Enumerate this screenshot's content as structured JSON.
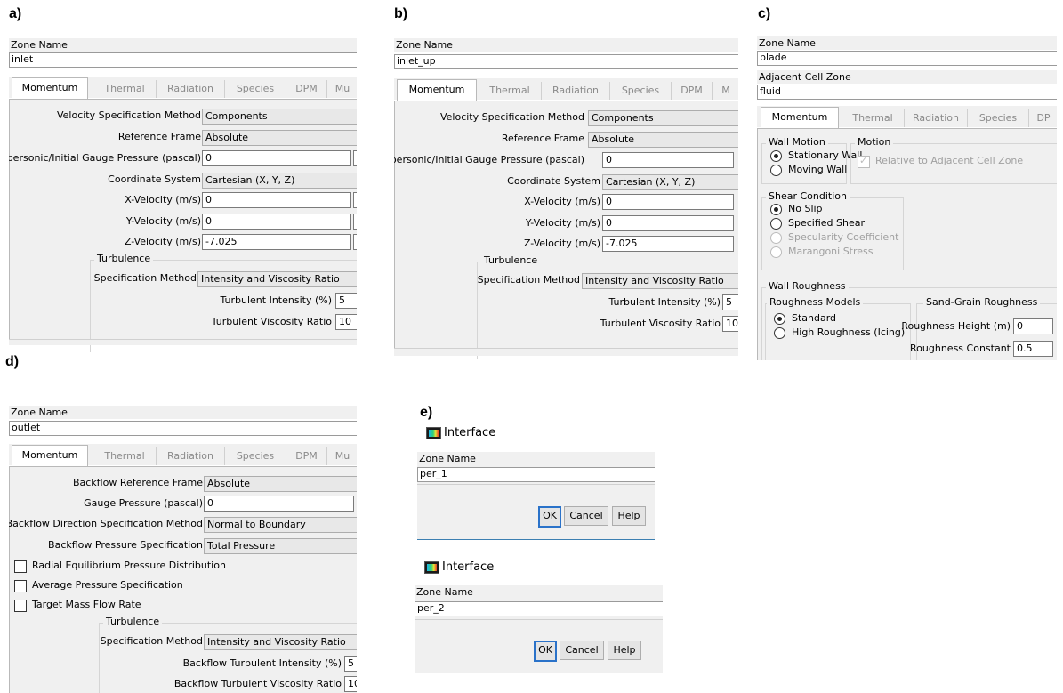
{
  "labels": {
    "a": "a)",
    "b": "b)",
    "c": "c)",
    "d": "d)",
    "e": "e)"
  },
  "common": {
    "zone_name_label": "Zone Name",
    "adjacent_cell_zone_label": "Adjacent Cell Zone",
    "tabs": [
      "Momentum",
      "Thermal",
      "Radiation",
      "Species",
      "DPM",
      "Mu"
    ],
    "tabs_b_last": "M",
    "tabs_c_last": "DP",
    "turbulence_label": "Turbulence",
    "spec_method_label": "Specification Method",
    "spec_method_value": "Intensity and Viscosity Ratio"
  },
  "panel_a": {
    "zone_name": "inlet",
    "velocity_spec_label": "Velocity Specification Method",
    "velocity_spec_value": "Components",
    "ref_frame_label": "Reference Frame",
    "ref_frame_value": "Absolute",
    "gauge_label": "Supersonic/Initial Gauge Pressure (pascal)",
    "gauge_value": "0",
    "coord_label": "Coordinate System",
    "coord_value": "Cartesian (X, Y, Z)",
    "xvel_label": "X-Velocity (m/s)",
    "xvel_value": "0",
    "yvel_label": "Y-Velocity (m/s)",
    "yvel_value": "0",
    "zvel_label": "Z-Velocity (m/s)",
    "zvel_value": "-7.025",
    "ti_label": "Turbulent Intensity (%)",
    "ti_value": "5",
    "tvr_label": "Turbulent Viscosity Ratio",
    "tvr_value": "10"
  },
  "panel_b": {
    "zone_name": "inlet_up"
  },
  "panel_c": {
    "zone_name": "blade",
    "adjacent_zone": "fluid",
    "wall_motion_title": "Wall Motion",
    "stationary_wall": "Stationary Wall",
    "moving_wall": "Moving Wall",
    "motion_title": "Motion",
    "relative_label": "Relative to Adjacent Cell Zone",
    "shear_title": "Shear Condition",
    "no_slip": "No Slip",
    "specified_shear": "Specified Shear",
    "specularity": "Specularity Coefficient",
    "marangoni": "Marangoni Stress",
    "wall_roughness_title": "Wall Roughness",
    "roughness_models_title": "Roughness Models",
    "standard": "Standard",
    "high_roughness": "High Roughness (Icing)",
    "sand_grain_title": "Sand-Grain Roughness",
    "rough_height_label": "Roughness Height (m)",
    "rough_height_value": "0",
    "rough_const_label": "Roughness Constant",
    "rough_const_value": "0.5"
  },
  "panel_d": {
    "zone_name": "outlet",
    "backflow_ref_label": "Backflow Reference Frame",
    "backflow_ref_value": "Absolute",
    "gauge_label": "Gauge Pressure (pascal)",
    "gauge_value": "0",
    "backflow_dir_label": "Backflow Direction Specification Method",
    "backflow_dir_value": "Normal to Boundary",
    "backflow_press_label": "Backflow Pressure Specification",
    "backflow_press_value": "Total Pressure",
    "radial_eq": "Radial Equilibrium Pressure Distribution",
    "avg_press": "Average Pressure Specification",
    "target_mass": "Target Mass Flow Rate",
    "bti_label": "Backflow Turbulent Intensity (%)",
    "bti_value": "5",
    "btvr_label": "Backflow Turbulent Viscosity Ratio",
    "btvr_value": "10"
  },
  "panel_e": {
    "dialog_title": "Interface",
    "zone1": "per_1",
    "zone2": "per_2",
    "ok": "OK",
    "cancel": "Cancel",
    "help": "Help"
  }
}
